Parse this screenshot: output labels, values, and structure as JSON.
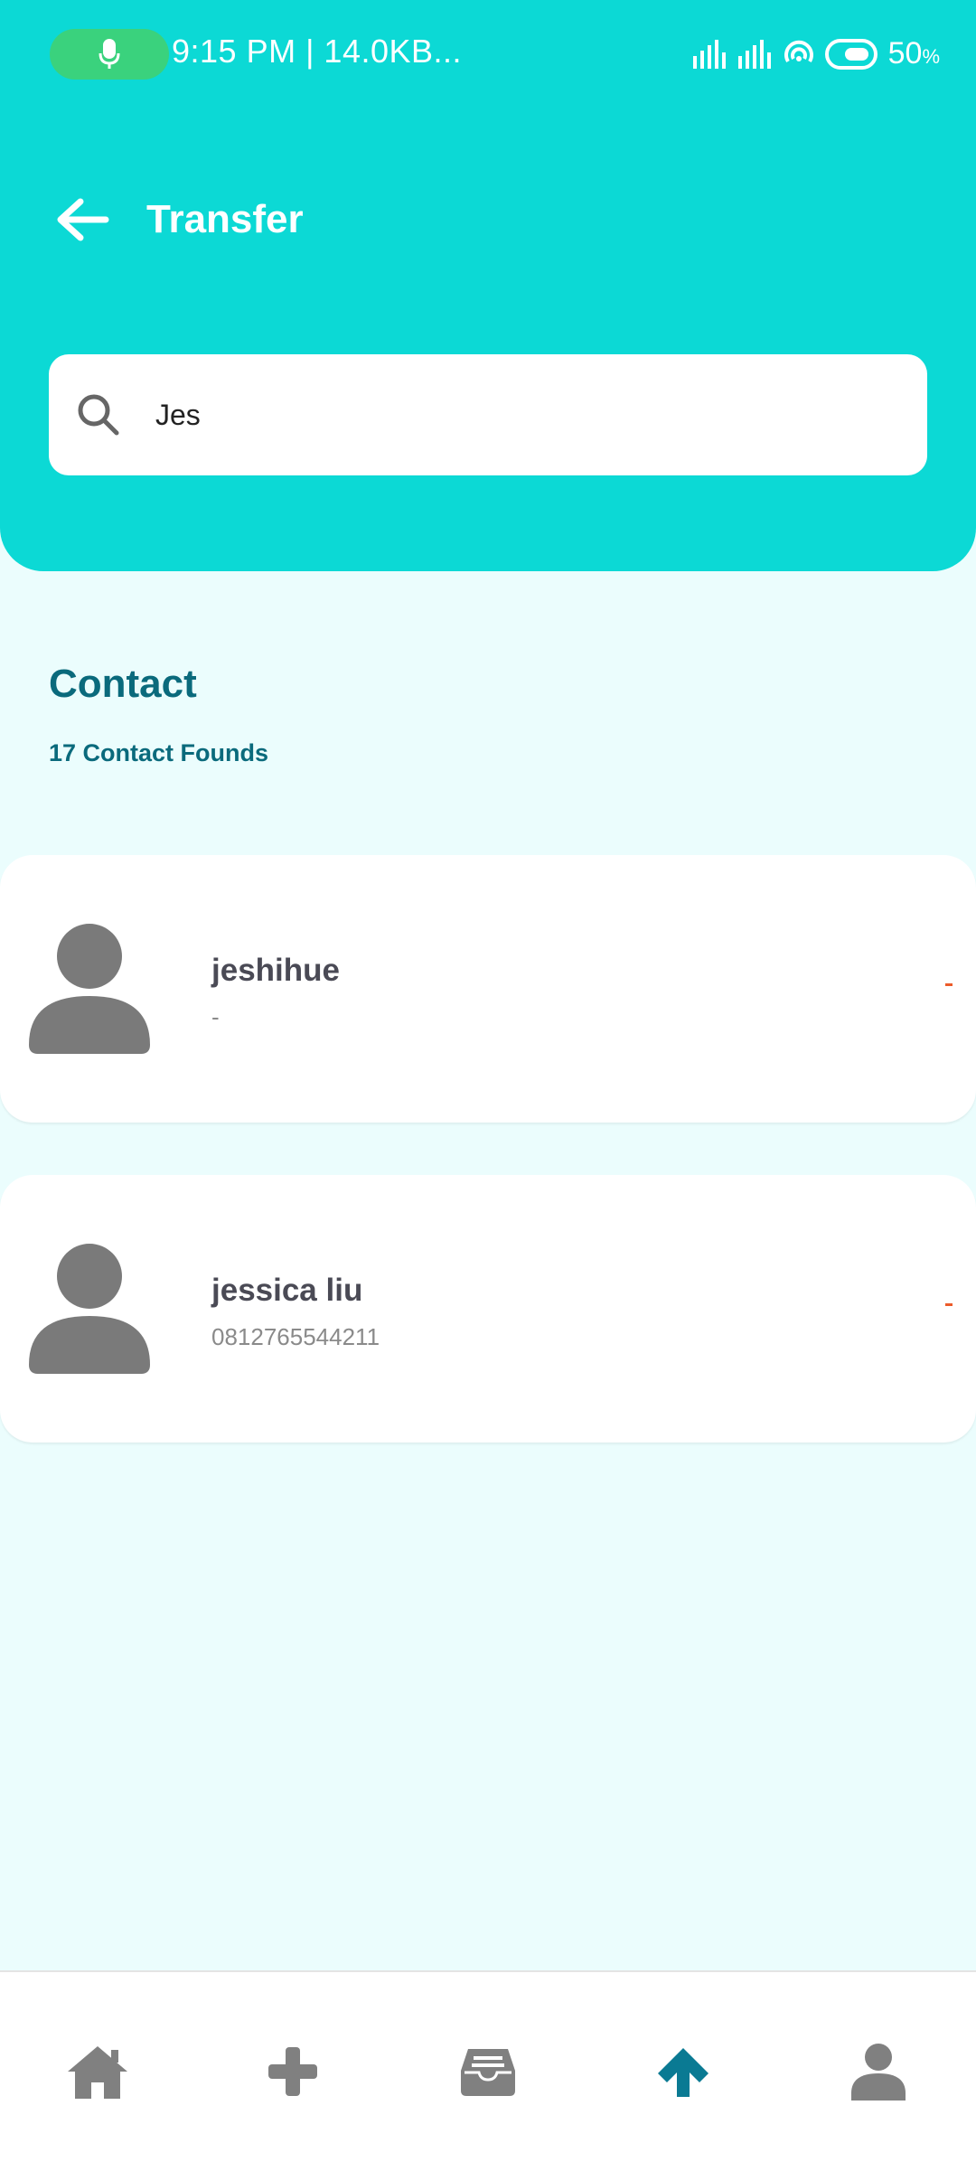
{
  "status_bar": {
    "text": "9:15 PM | 14.0KB...",
    "battery": "50",
    "battery_unit": "%"
  },
  "header": {
    "title": "Transfer"
  },
  "search": {
    "value": "Jes"
  },
  "section": {
    "title": "Contact",
    "subtitle": "17 Contact Founds"
  },
  "contacts": [
    {
      "name": "jeshihue",
      "phone": "-",
      "flag": "-"
    },
    {
      "name": "jessica liu",
      "phone": "0812765544211",
      "flag": "-"
    }
  ],
  "colors": {
    "header_bg": "#0cd9d5",
    "page_bg": "#ebfdfd",
    "accent": "#0a6a7c",
    "active_nav": "#0a7a93",
    "inactive_nav": "#808080",
    "flag": "#ec5b2a"
  },
  "bottom_nav": [
    {
      "icon": "home-icon",
      "active": false
    },
    {
      "icon": "plus-icon",
      "active": false
    },
    {
      "icon": "inbox-icon",
      "active": false
    },
    {
      "icon": "arrow-up-icon",
      "active": true
    },
    {
      "icon": "user-icon",
      "active": false
    }
  ]
}
